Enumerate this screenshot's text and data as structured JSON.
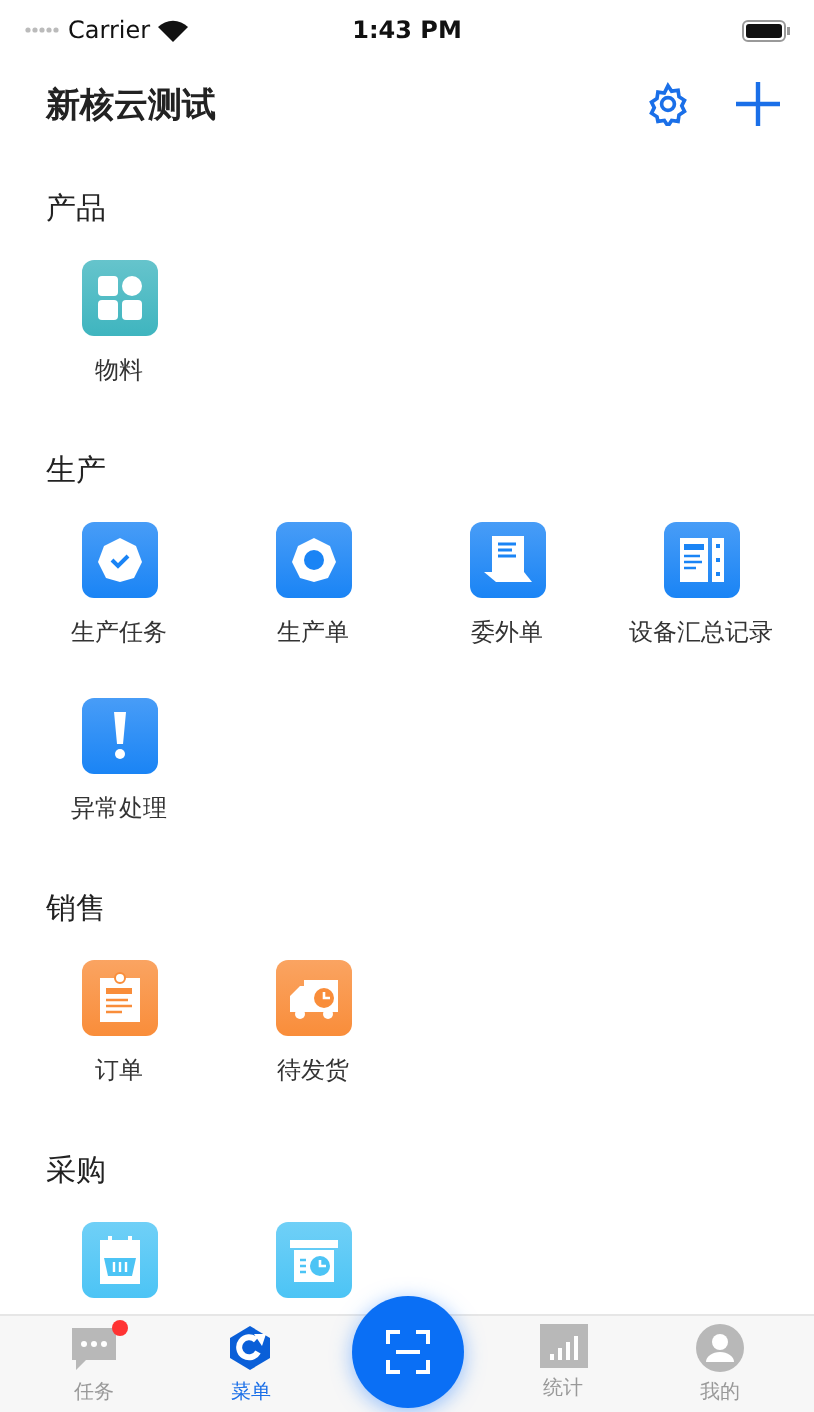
{
  "status_bar": {
    "carrier": "Carrier",
    "time": "1:43 PM"
  },
  "header": {
    "title": "新核云测试"
  },
  "sections": [
    {
      "title": "产品",
      "items": [
        {
          "label": "物料",
          "kind": "grid",
          "color": "#3fb5bf"
        }
      ]
    },
    {
      "title": "生产",
      "items": [
        {
          "label": "生产任务",
          "kind": "check",
          "color": "#1a84f5"
        },
        {
          "label": "生产单",
          "kind": "ring",
          "color": "#1a84f5"
        },
        {
          "label": "委外单",
          "kind": "document",
          "color": "#1a84f5"
        },
        {
          "label": "设备汇总记录",
          "kind": "panel",
          "color": "#1a84f5"
        },
        {
          "label": "异常处理",
          "kind": "alert",
          "color": "#1a84f5"
        }
      ]
    },
    {
      "title": "销售",
      "items": [
        {
          "label": "订单",
          "kind": "clipboard",
          "color": "#f98d3a"
        },
        {
          "label": "待发货",
          "kind": "truck",
          "color": "#f98d3a"
        }
      ]
    },
    {
      "title": "采购",
      "items": [
        {
          "kind": "basket",
          "color": "#4cc4f5"
        },
        {
          "kind": "box",
          "color": "#4cc4f5"
        }
      ]
    }
  ],
  "tab_bar": [
    {
      "kind": "tab",
      "label": "任务",
      "selected": false,
      "badge": true
    },
    {
      "kind": "tab",
      "label": "菜单",
      "selected": true,
      "badge": false
    },
    {
      "kind": "scan"
    },
    {
      "kind": "tab",
      "label": "统计",
      "selected": false,
      "badge": false
    },
    {
      "kind": "tab",
      "label": "我的",
      "selected": false,
      "badge": false
    }
  ]
}
